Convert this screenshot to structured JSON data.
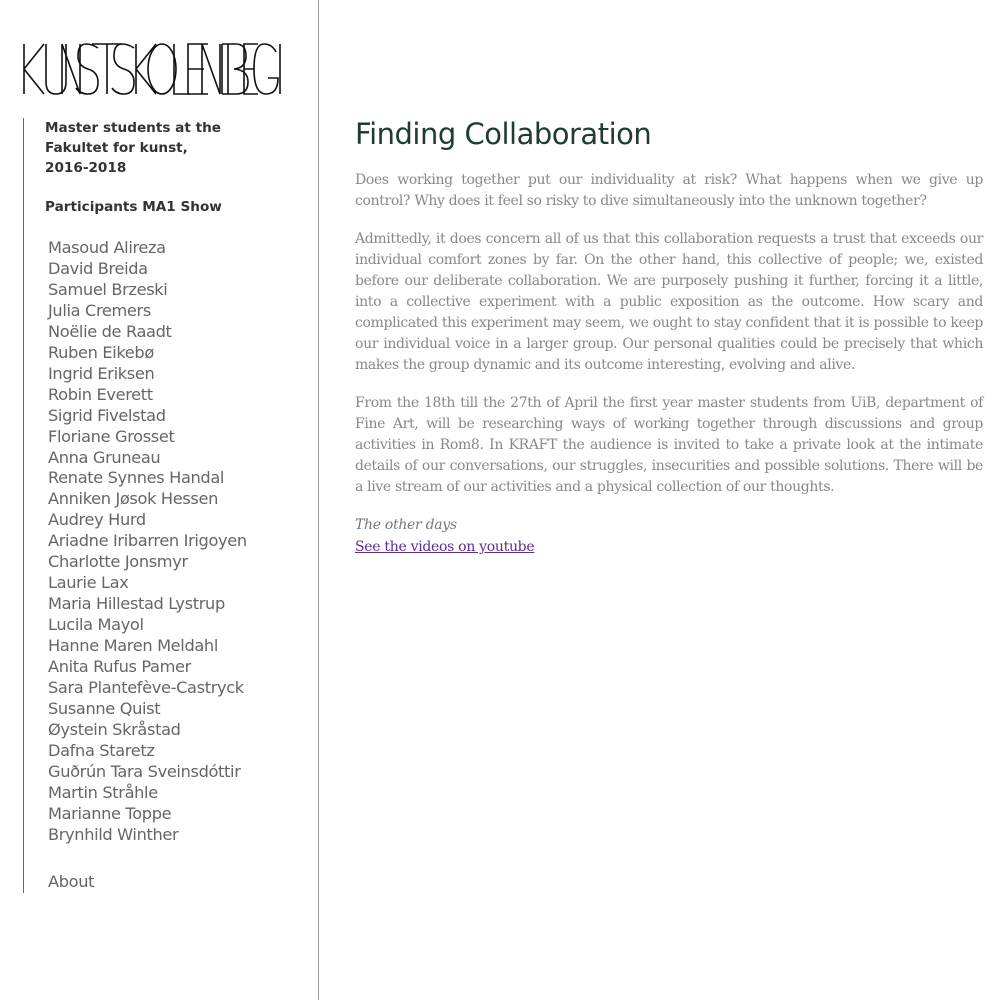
{
  "brand": {
    "logo_text": "KUNSTSKOLEN I BERGEN"
  },
  "sidebar": {
    "intro": "Master students at the Fakultet for kunst, 2016-2018",
    "participants_heading": "Participants MA1 Show",
    "names": [
      "Masoud Alireza",
      "David Breida",
      "Samuel Brzeski",
      "Julia Cremers",
      "Noëlie de Raadt",
      "Ruben Eikebø",
      "Ingrid Eriksen",
      "Robin Everett",
      "Sigrid Fivelstad",
      "Floriane Grosset",
      "Anna Gruneau",
      "Renate Synnes Handal",
      "Anniken Jøsok Hessen",
      "Audrey Hurd",
      "Ariadne Iribarren Irigoyen",
      "Charlotte Jonsmyr",
      "Laurie Lax",
      "Maria Hillestad Lystrup",
      "Lucila Mayol",
      "Hanne Maren Meldahl",
      "Anita Rufus Pamer",
      "Sara Plantefève-Castryck",
      "Susanne Quist",
      "Øystein Skråstad",
      "Dafna Staretz",
      "Guðrún Tara Sveinsdóttir",
      "Martin Stråhle",
      "Marianne Toppe",
      "Brynhild Winther"
    ],
    "about_label": "About"
  },
  "main": {
    "title": "Finding Collaboration",
    "paragraphs": [
      "Does working together put our individuality at risk? What happens when we give up control? Why does it feel so risky to dive simultaneously into the unknown together?",
      "Admittedly, it does concern all of us that this collaboration requests a trust that exceeds our individual comfort zones by far. On the other hand, this collective of people; we, existed before our deliberate collaboration. We are purposely pushing it further, forcing it a little, into a collective experiment with a public exposition as the outcome. How scary and complicated this experiment may seem, we ought to stay confident that it is possible to keep our individual voice in a larger group. Our personal qualities could be precisely that which makes the group dynamic and its outcome interesting, evolving and alive.",
      "From the 18th till the 27th of April the first year master students from UiB, department of Fine Art, will be researching ways of working together through discussions and group activities in Rom8. In KRAFT the audience is invited to take a private look at the intimate details of our conversations, our struggles, insecurities and possible solutions. There will be a live stream of our activities and a physical collection of our thoughts."
    ],
    "other_days": "The other days",
    "youtube_link": "See the videos on youtube"
  },
  "colors": {
    "title": "#1e3d2c",
    "body_text": "#888888",
    "sidebar_names": "#666666",
    "link": "#5b2d8e"
  }
}
